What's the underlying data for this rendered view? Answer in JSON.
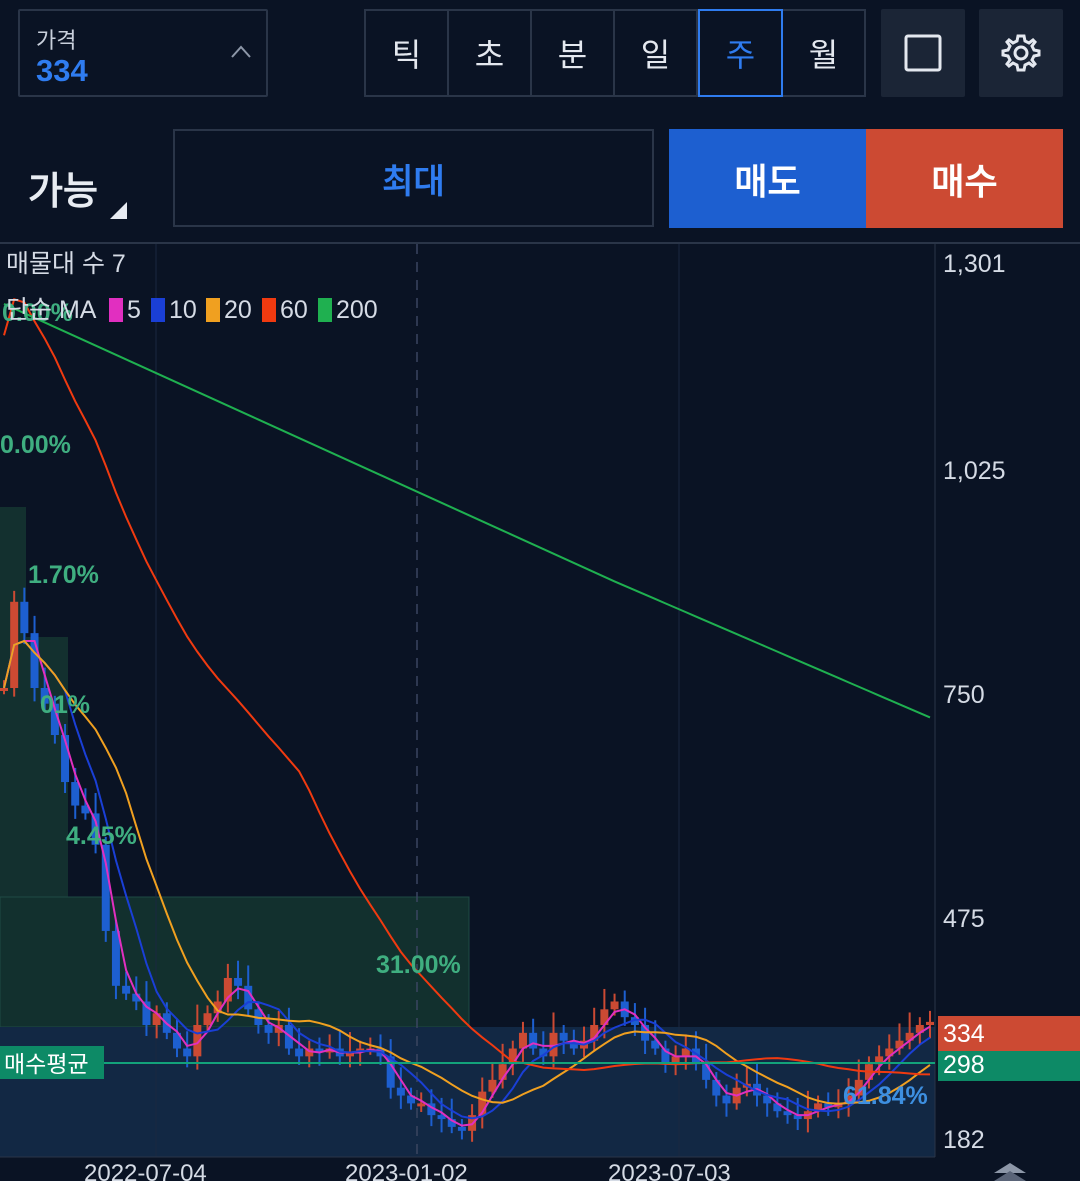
{
  "header": {
    "price_label": "가격",
    "price_value": "334",
    "periods": [
      "틱",
      "초",
      "분",
      "일",
      "주",
      "월"
    ],
    "active_period": "주",
    "icons": [
      "square-icon",
      "gear-icon"
    ]
  },
  "order": {
    "avail_label": "가능",
    "qty_label": "최대",
    "sell_label": "매도",
    "buy_label": "매수"
  },
  "colors": {
    "background": "#0a1324",
    "accent": "#2f7cf0",
    "up": "#cc4a33",
    "down": "#1d5fd0",
    "avg_line": "#13a27a"
  },
  "chart_data": {
    "type": "candlestick",
    "indicator_label": "매물대 수 7",
    "ma_prefix": "단순 MA",
    "ma_series": [
      {
        "period": "5",
        "color": "#e12fc0"
      },
      {
        "period": "10",
        "color": "#1a3fd6"
      },
      {
        "period": "20",
        "color": "#f0a020"
      },
      {
        "period": "60",
        "color": "#f03a10"
      },
      {
        "period": "200",
        "color": "#1fb050"
      }
    ],
    "y_ticks": [
      "1,301",
      "1,025",
      "750",
      "475",
      "182"
    ],
    "x_ticks": [
      "2022-07-04",
      "2023-01-02",
      "2023-07-03"
    ],
    "current_price": "334",
    "avg_price": "298",
    "avg_label": "매수평균",
    "fib_labels": [
      "0.00%",
      "0.00%",
      "1.70%",
      "01%",
      "4.45%",
      "31.00%",
      "61.84%"
    ],
    "ylim": [
      182,
      1301
    ]
  }
}
